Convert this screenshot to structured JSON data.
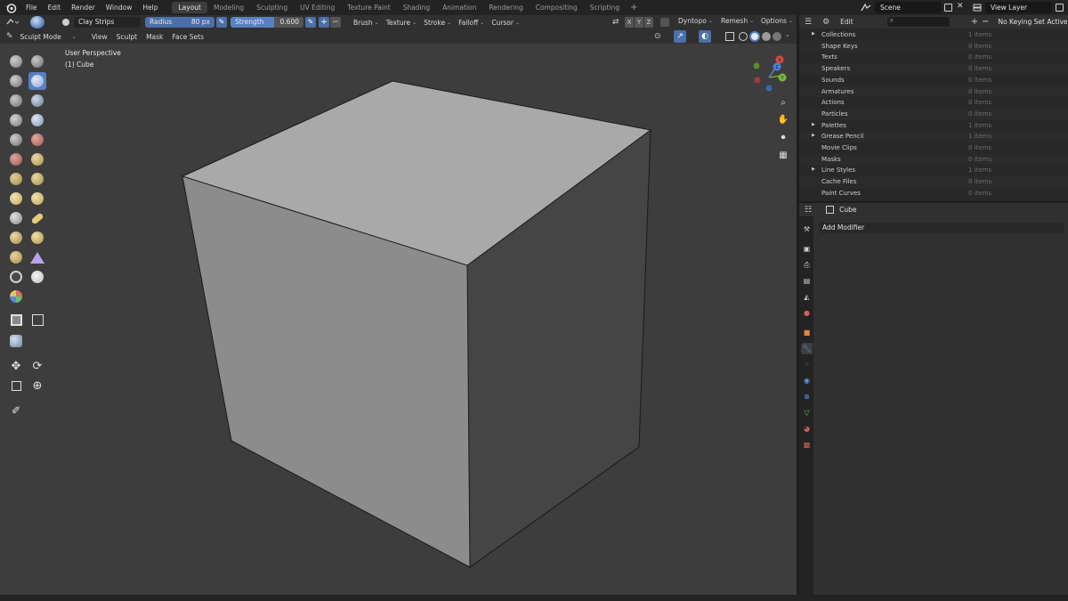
{
  "menu": [
    "File",
    "Edit",
    "Render",
    "Window",
    "Help"
  ],
  "workspaces": [
    "Layout",
    "Modeling",
    "Sculpting",
    "UV Editing",
    "Texture Paint",
    "Shading",
    "Animation",
    "Rendering",
    "Compositing",
    "Scripting"
  ],
  "workspace_active": "Layout",
  "workspace_add": "+",
  "scene": {
    "name": "Scene",
    "view_layer": "View Layer"
  },
  "tool_settings": {
    "brush_name": "Clay Strips",
    "radius_label": "Radius",
    "radius_value": "80 px",
    "strength_label": "Strength",
    "strength_value": "0.600",
    "plus": "+",
    "minus": "−",
    "dropdowns": [
      "Brush",
      "Texture",
      "Stroke",
      "Falloff",
      "Cursor"
    ],
    "axes": [
      "X",
      "Y",
      "Z"
    ],
    "dyntopo": "Dyntopo",
    "remesh": "Remesh",
    "options": "Options"
  },
  "view_header": {
    "mode": "Sculpt Mode",
    "menus": [
      "View",
      "Sculpt",
      "Mask",
      "Face Sets"
    ]
  },
  "viewport": {
    "perspective": "User Perspective",
    "object": "(1) Cube",
    "gizmo_axes": [
      "X",
      "Y",
      "Z"
    ]
  },
  "outliner": {
    "mode": "Edit",
    "search_placeholder": "",
    "keying": "No Keying Set Active",
    "rows": [
      {
        "name": "Collections",
        "count": "1 items",
        "expand": true
      },
      {
        "name": "Shape Keys",
        "count": "0 items",
        "expand": false
      },
      {
        "name": "Texts",
        "count": "0 items",
        "expand": false
      },
      {
        "name": "Speakers",
        "count": "0 items",
        "expand": false
      },
      {
        "name": "Sounds",
        "count": "0 items",
        "expand": false
      },
      {
        "name": "Armatures",
        "count": "0 items",
        "expand": false
      },
      {
        "name": "Actions",
        "count": "0 items",
        "expand": false
      },
      {
        "name": "Particles",
        "count": "0 items",
        "expand": false
      },
      {
        "name": "Palettes",
        "count": "1 items",
        "expand": true
      },
      {
        "name": "Grease Pencil",
        "count": "1 items",
        "expand": true
      },
      {
        "name": "Movie Clips",
        "count": "0 items",
        "expand": false
      },
      {
        "name": "Masks",
        "count": "0 items",
        "expand": false
      },
      {
        "name": "Line Styles",
        "count": "1 items",
        "expand": true
      },
      {
        "name": "Cache Files",
        "count": "0 items",
        "expand": false
      },
      {
        "name": "Paint Curves",
        "count": "0 items",
        "expand": false
      }
    ]
  },
  "properties": {
    "object_name": "Cube",
    "add_modifier": "Add Modifier"
  },
  "colors": {
    "accent": "#5680c2",
    "viewport_bg": "#3d3d3d",
    "cube_top": "#a9a9a9",
    "cube_left": "#8c8c8c",
    "cube_right": "#454545"
  }
}
